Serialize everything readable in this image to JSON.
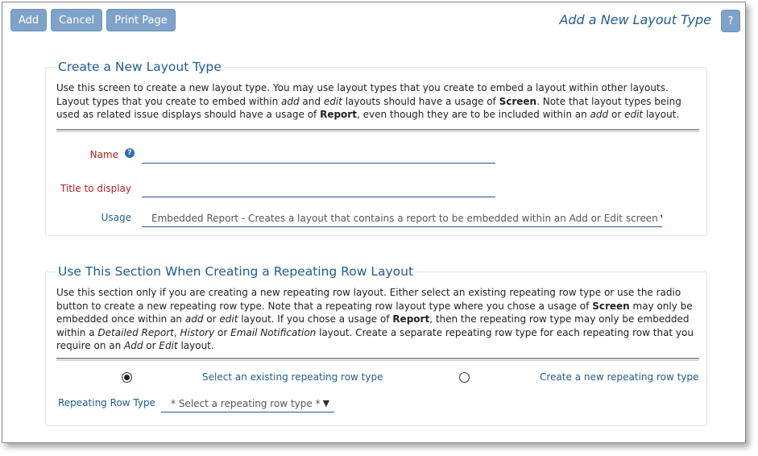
{
  "toolbar": {
    "add_label": "Add",
    "cancel_label": "Cancel",
    "print_label": "Print Page"
  },
  "header": {
    "title": "Add a New Layout Type",
    "help_label": "?"
  },
  "section1": {
    "title": "Create a New Layout Type",
    "description_parts": [
      "Use this screen to create a new layout type. You may use layout types that you create to embed a layout within other layouts. Layout types that you create to embed within ",
      "add",
      " and ",
      "edit",
      " layouts should have a usage of ",
      "Screen",
      ". Note that layout types being used as related issue displays should have a usage of ",
      "Report",
      ", even though they are to be included within an ",
      "add",
      " or ",
      "edit",
      " layout."
    ],
    "fields": {
      "name_label": "Name",
      "name_value": "",
      "title_label": "Title to display",
      "title_value": "",
      "usage_label": "Usage",
      "usage_value": "Embedded Report - Creates a layout that contains a report to be embedded within an Add or Edit screen"
    }
  },
  "section2": {
    "title": "Use This Section When Creating a Repeating Row Layout",
    "description_parts": [
      "Use this section only if you are creating a new repeating row layout. Either select an existing repeating row type or use the radio button to create a new repeating row type. Note that a repeating row layout type where you chose a usage of ",
      "Screen",
      " may only be embedded once within an ",
      "add",
      " or ",
      "edit",
      " layout. If you chose a usage of ",
      "Report",
      ", then the repeating row type may only be embedded within a ",
      "Detailed Report",
      ", ",
      "History",
      " or ",
      "Email Notification",
      " layout. Create a separate repeating row type for each repeating row that you require on an ",
      "Add",
      " or ",
      "Edit",
      " layout."
    ],
    "radio_existing_label": "Select an existing repeating row type",
    "radio_new_label": "Create a new repeating row type",
    "selected_option": "existing",
    "repeating_row_label": "Repeating Row Type",
    "repeating_row_value": "* Select a repeating row type *"
  },
  "icons": {
    "dropdown_arrow": "▼",
    "help_glyph": "?"
  },
  "colors": {
    "button_bg": "#7fa3c8",
    "title_blue": "#1f5b93",
    "required_red": "#b22222"
  }
}
